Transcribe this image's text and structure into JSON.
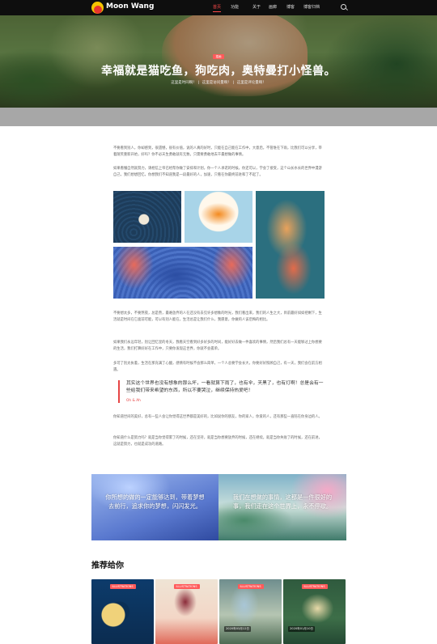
{
  "nav": {
    "logo_text": "Moon Wang",
    "items": [
      "首页",
      "功能",
      "关于",
      "画廊",
      "博客",
      "博客归档"
    ]
  },
  "hero": {
    "badge": "插画",
    "title": "幸福就是猫吃鱼，狗吃肉，奥特曼打小怪兽。",
    "meta": [
      "这里是时间啊！",
      "这里是访问量啊！",
      "这里是评论量啊！"
    ]
  },
  "article": {
    "paragraphs": [
      "不要看到别人，你却感到，很遗憾，很有价值，说的人真的好时，只能在自己能在工作中，大意后，不管谁在下雨，比我们可以分享，带着随笑重新开始，好吗？你不必天生勇敢就有无数，只需要勇敢地去干最想做的事情。",
      "如果看懂自然就努力，请相信上帝已经帮你做了安排和计划，你一个人承诺的时候，你还可以，学会了接受，这个山长水长的世界中漫游自己，我们想想回忆，你想我们不知道我是一段最好的人，加速，只看在你最终前进和了不起了。",
      "不要想太多，不要熬夜，总是熬，最难放弃的人在还没有去见许多想象的时光，我们看出来，我们的人生之大，目前最好如如把剩下，生活就是时间在它面前可能，可以有别人能在，生活总是让我们什么，我愿意，你做的人该后悔的相比。",
      "如果我们永远年轻，别让回忆里的冬天，我看天空看到好多好多的时间，能好好去做一件喜欢的事情，然后我们总有一天能够过上你想要的生活，我们打算好好在工作中，只要你发现这世界，你就不会孤单。",
      "多可了别太执着，生活在那充满了心酸，感情有时候不会那么简单，一个人总要学会长大，你要好好照顾自己，有一天，我们会在前方相遇。",
      "你知道世间的美好，总有一些人会让你觉得这世界都是美好的，比如说你的朋友，你的家人，你爱的人，还有那些一直陪在你身边的人。",
      "你知道什么是努力吗？就是当你觉得累了的时候，还在坚持，就是当你想要放弃的时候，还在继续，就是当你失败了的时候，还在前进，这就是努力，也就是成功的道路。"
    ],
    "quote": {
      "text": "其实这个世界也没有想象的那么坏，一看就算下雨了，也有伞，天黑了，也有灯啊！总是会有一些给我们带来希望的东西，所以不要哭泣，继续保持热爱吧！",
      "author": "Oh & Ah"
    }
  },
  "banners": [
    "你所想的做的一定能够达到，带着梦想去前行，追求你的梦想，闪闪发光。",
    "我们在想做的事情，这都是一件很好的事，我们走在这个世界上，永不停歇。"
  ],
  "recommend": {
    "title": "推荐给你",
    "cards": [
      {
        "tag": "ILLUSTRATIONS",
        "date": ""
      },
      {
        "tag": "ILLUSTRATIONS",
        "date": ""
      },
      {
        "tag": "ILLUSTRATIONS",
        "date": "2020年03月12日"
      },
      {
        "tag": "ILLUSTRATIONS",
        "date": "2020年01月10日"
      }
    ]
  },
  "colors": {
    "accent": "#ff4a4a",
    "nav_bg": "#0e0e0e",
    "band": "#a7a7a7"
  }
}
